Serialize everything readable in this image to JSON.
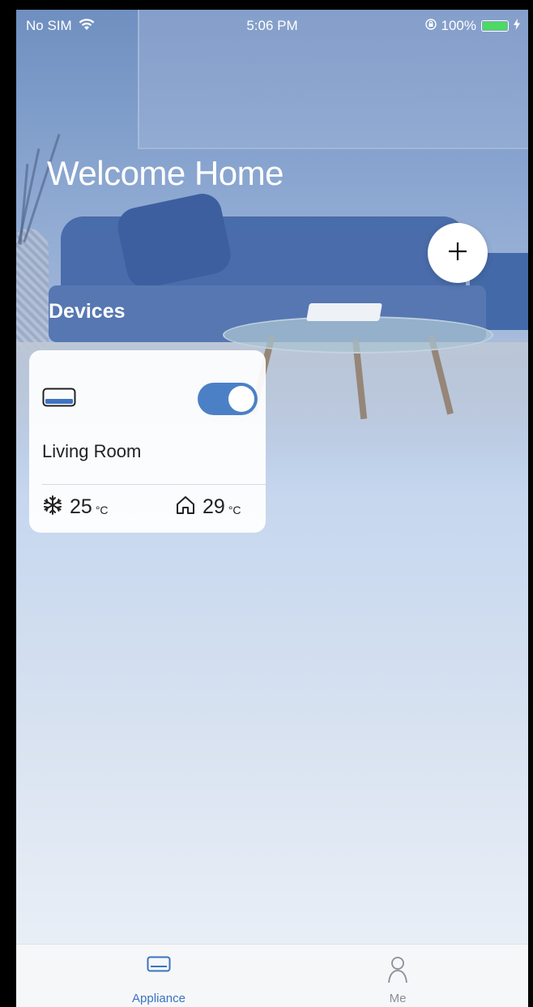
{
  "status_bar": {
    "carrier": "No SIM",
    "time": "5:06 PM",
    "battery": "100%"
  },
  "header": {
    "title": "Welcome Home",
    "add_button_glyph": "+"
  },
  "devices_section": {
    "label": "Devices",
    "items": [
      {
        "name": "Living Room",
        "icon": "air-conditioner-icon",
        "power_on": true,
        "set_temp": "25",
        "set_temp_unit": "°C",
        "indoor_temp": "29",
        "indoor_temp_unit": "°C"
      }
    ]
  },
  "tabbar": {
    "tabs": [
      {
        "label": "Appliance",
        "icon": "appliance-icon",
        "active": true
      },
      {
        "label": "Me",
        "icon": "person-icon",
        "active": false
      }
    ]
  },
  "colors": {
    "accent": "#4c80c6",
    "tab_active": "#3a73c0",
    "tab_inactive": "#8a8f98",
    "toggle_on": "#4c80c6"
  }
}
